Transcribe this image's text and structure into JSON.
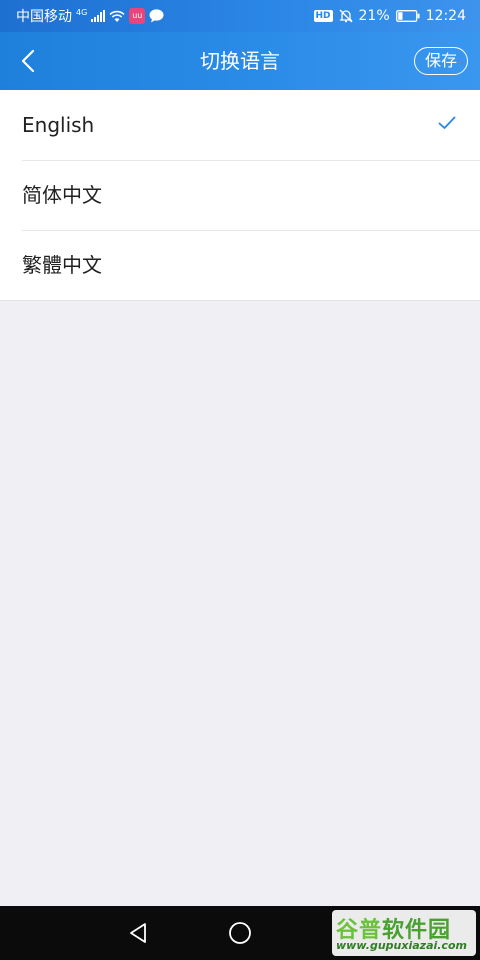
{
  "status_bar": {
    "carrier": "中国移动",
    "network": "4G",
    "battery_percent": "21%",
    "time": "12:24",
    "hd_label": "HD",
    "app_badge": "uu"
  },
  "header": {
    "title": "切换语言",
    "save_label": "保存"
  },
  "languages": [
    {
      "label": "English",
      "selected": true
    },
    {
      "label": "简体中文",
      "selected": false
    },
    {
      "label": "繁體中文",
      "selected": false
    }
  ],
  "watermark": {
    "name_part1": "谷普",
    "name_part2": "软件园",
    "url": "www.gupuxiazai.com"
  },
  "colors": {
    "accent": "#2a86e6",
    "check": "#2a86e6",
    "background": "#efeff4"
  },
  "icons": {
    "back": "chevron-left-icon",
    "check": "check-icon",
    "nav_back": "triangle-back-icon",
    "nav_home": "circle-home-icon"
  }
}
